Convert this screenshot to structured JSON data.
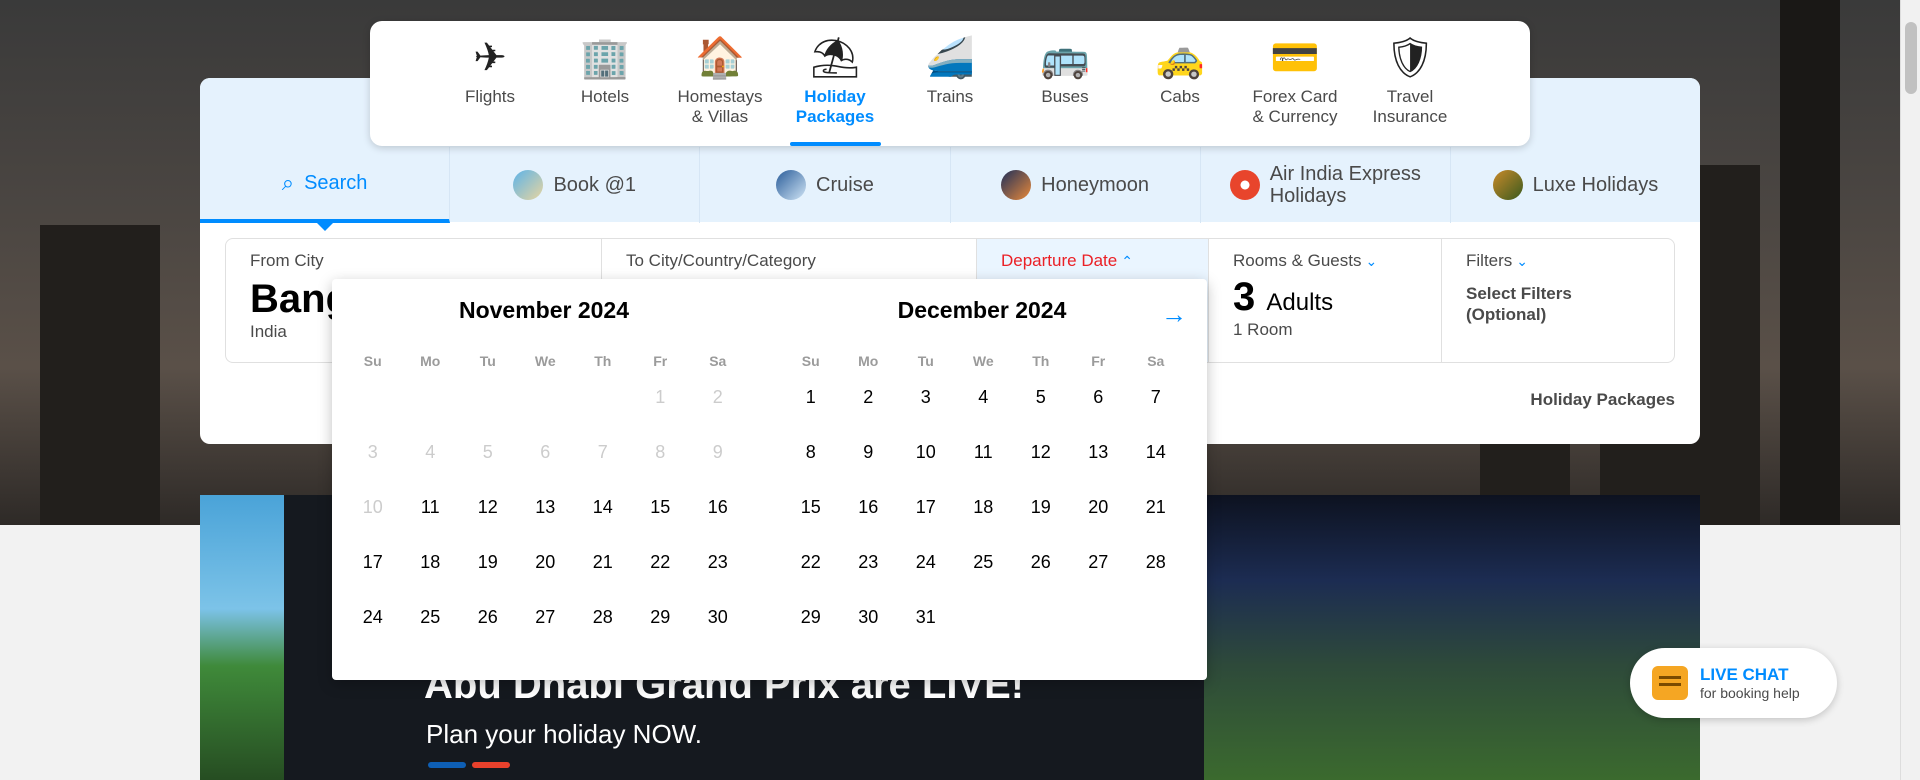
{
  "nav": {
    "items": [
      {
        "label": "Flights",
        "icon": "✈"
      },
      {
        "label": "Hotels",
        "icon": "🏢"
      },
      {
        "label": "Homestays\n& Villas",
        "icon": "🏠"
      },
      {
        "label": "Holiday\nPackages",
        "icon": "⛱"
      },
      {
        "label": "Trains",
        "icon": "🚄"
      },
      {
        "label": "Buses",
        "icon": "🚌"
      },
      {
        "label": "Cabs",
        "icon": "🚕"
      },
      {
        "label": "Forex Card\n& Currency",
        "icon": "💳"
      },
      {
        "label": "Travel\nInsurance",
        "icon": "🛡"
      }
    ],
    "active_index": 3
  },
  "subtabs": [
    {
      "label": "Search"
    },
    {
      "label": "Book @1"
    },
    {
      "label": "Cruise"
    },
    {
      "label": "Honeymoon"
    },
    {
      "label": "Air India Express\nHolidays"
    },
    {
      "label": "Luxe Holidays"
    }
  ],
  "form": {
    "from": {
      "label": "From City",
      "value": "Bangalore",
      "sub": "India"
    },
    "to": {
      "label": "To City/Country/Category"
    },
    "date": {
      "label": "Departure Date"
    },
    "rooms": {
      "label": "Rooms & Guests",
      "count": "3",
      "unit": "Adults",
      "sub": "1 Room"
    },
    "filters": {
      "label": "Filters",
      "value": "Select Filters\n(Optional)"
    }
  },
  "holiday_link": "Holiday Packages",
  "calendar": {
    "dow": [
      "Su",
      "Mo",
      "Tu",
      "We",
      "Th",
      "Fr",
      "Sa"
    ],
    "months": [
      {
        "title": "November 2024",
        "first_dow": 5,
        "days": 30,
        "disabled_until": 10
      },
      {
        "title": "December 2024",
        "first_dow": 0,
        "days": 31,
        "disabled_until": 0
      }
    ],
    "next_icon": "→"
  },
  "banner": {
    "headline": "Abu Dhabi Grand Prix are LIVE!",
    "sub": "Plan your holiday NOW."
  },
  "chat": {
    "title": "LIVE CHAT",
    "sub": "for booking help"
  },
  "colors": {
    "accent": "#008cff",
    "date_label": "#eb2026",
    "chat_icon": "#f5a623"
  }
}
